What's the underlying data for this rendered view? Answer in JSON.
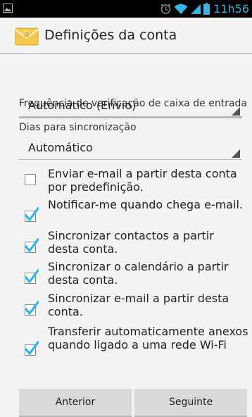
{
  "status_bar": {
    "time": "11h56",
    "icons": [
      "picture-icon",
      "alarm-icon",
      "wifi-icon",
      "signal-icon",
      "battery-icon"
    ],
    "accent_color": "#33b5e5"
  },
  "action_bar": {
    "title": "Definições da conta",
    "icon": "email-envelope-icon"
  },
  "form": {
    "inbox_check": {
      "label": "Frequência de verificação de caixa de entrada",
      "value": "Automático (Envio)"
    },
    "sync_days": {
      "label": "Dias para sincronização",
      "value": "Automático"
    },
    "checkboxes": [
      {
        "label": "Enviar e-mail a partir desta conta por predefinição.",
        "checked": false
      },
      {
        "label": "Notificar-me quando chega e-mail.",
        "checked": true
      },
      {
        "label": "Sincronizar contactos a partir desta conta.",
        "checked": true
      },
      {
        "label": "Sincronizar o calendário a partir desta conta.",
        "checked": true
      },
      {
        "label": "Sincronizar e-mail a partir desta conta.",
        "checked": true
      },
      {
        "label": "Transferir automaticamente anexos quando ligado a uma rede Wi-Fi",
        "checked": true
      }
    ]
  },
  "buttons": {
    "previous": "Anterior",
    "next": "Seguinte"
  }
}
